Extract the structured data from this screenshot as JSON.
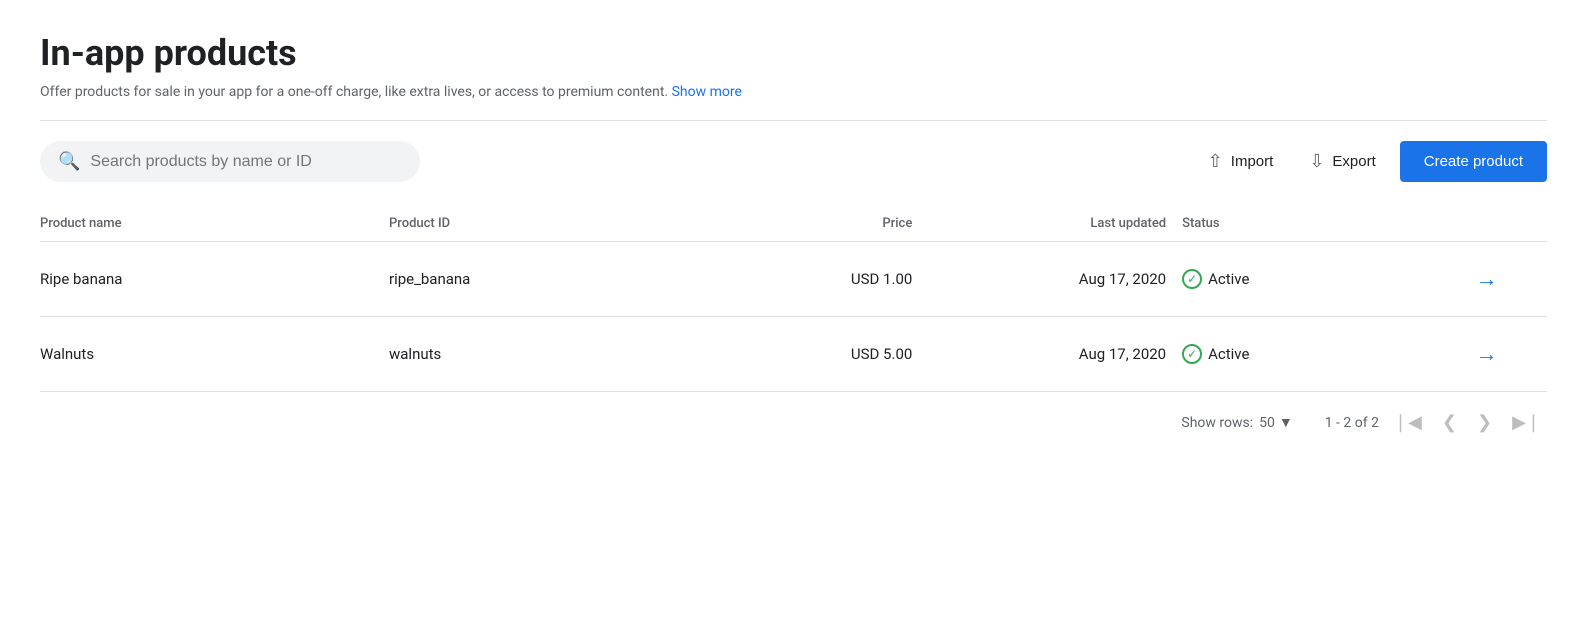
{
  "page": {
    "title": "In-app products",
    "subtitle": "Offer products for sale in your app for a one-off charge, like extra lives, or access to premium content.",
    "show_more_label": "Show more"
  },
  "toolbar": {
    "search_placeholder": "Search products by name or ID",
    "import_label": "Import",
    "export_label": "Export",
    "create_label": "Create product"
  },
  "table": {
    "columns": [
      {
        "key": "name",
        "label": "Product name"
      },
      {
        "key": "id",
        "label": "Product ID"
      },
      {
        "key": "price",
        "label": "Price"
      },
      {
        "key": "updated",
        "label": "Last updated"
      },
      {
        "key": "status",
        "label": "Status"
      }
    ],
    "rows": [
      {
        "name": "Ripe banana",
        "product_id": "ripe_banana",
        "price": "USD 1.00",
        "last_updated": "Aug 17, 2020",
        "status": "Active"
      },
      {
        "name": "Walnuts",
        "product_id": "walnuts",
        "price": "USD 5.00",
        "last_updated": "Aug 17, 2020",
        "status": "Active"
      }
    ]
  },
  "pagination": {
    "show_rows_label": "Show rows:",
    "rows_per_page": "50",
    "page_info": "1 - 2 of 2"
  },
  "colors": {
    "active_check": "#34a853",
    "arrow": "#1a73e8",
    "create_btn_bg": "#1a73e8"
  }
}
